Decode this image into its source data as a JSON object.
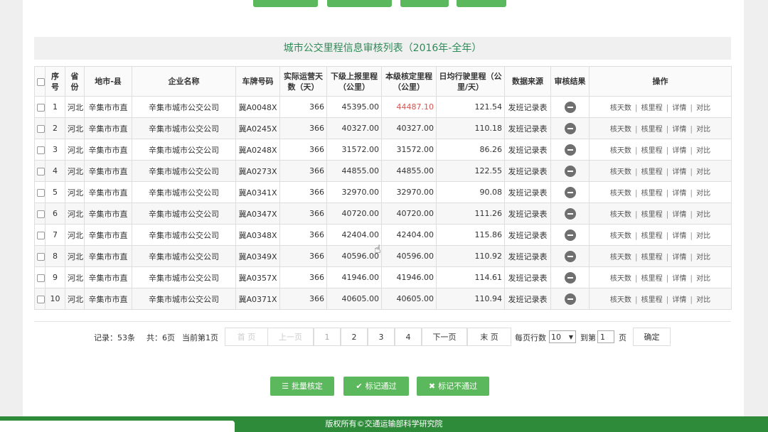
{
  "title": "城市公交里程信息审核列表（2016年-全年）",
  "columns": [
    "序号",
    "省份",
    "地市-县",
    "企业名称",
    "车牌号码",
    "实际运营天数（天）",
    "下级上报里程（公里）",
    "本级核定里程（公里）",
    "日均行驶里程（公里/天）",
    "数据来源",
    "审核结果",
    "操作"
  ],
  "rows": [
    {
      "no": "1",
      "province": "河北",
      "city": "辛集市市直",
      "company": "辛集市城市公交公司",
      "plate": "冀A0048X",
      "days": "366",
      "reported": "45395.00",
      "verified": "44487.10",
      "verified_flag": true,
      "daily": "121.54",
      "source": "发班记录表"
    },
    {
      "no": "2",
      "province": "河北",
      "city": "辛集市市直",
      "company": "辛集市城市公交公司",
      "plate": "冀A0245X",
      "days": "366",
      "reported": "40327.00",
      "verified": "40327.00",
      "verified_flag": false,
      "daily": "110.18",
      "source": "发班记录表"
    },
    {
      "no": "3",
      "province": "河北",
      "city": "辛集市市直",
      "company": "辛集市城市公交公司",
      "plate": "冀A0248X",
      "days": "366",
      "reported": "31572.00",
      "verified": "31572.00",
      "verified_flag": false,
      "daily": "86.26",
      "source": "发班记录表"
    },
    {
      "no": "4",
      "province": "河北",
      "city": "辛集市市直",
      "company": "辛集市城市公交公司",
      "plate": "冀A0273X",
      "days": "366",
      "reported": "44855.00",
      "verified": "44855.00",
      "verified_flag": false,
      "daily": "122.55",
      "source": "发班记录表"
    },
    {
      "no": "5",
      "province": "河北",
      "city": "辛集市市直",
      "company": "辛集市城市公交公司",
      "plate": "冀A0341X",
      "days": "366",
      "reported": "32970.00",
      "verified": "32970.00",
      "verified_flag": false,
      "daily": "90.08",
      "source": "发班记录表"
    },
    {
      "no": "6",
      "province": "河北",
      "city": "辛集市市直",
      "company": "辛集市城市公交公司",
      "plate": "冀A0347X",
      "days": "366",
      "reported": "40720.00",
      "verified": "40720.00",
      "verified_flag": false,
      "daily": "111.26",
      "source": "发班记录表"
    },
    {
      "no": "7",
      "province": "河北",
      "city": "辛集市市直",
      "company": "辛集市城市公交公司",
      "plate": "冀A0348X",
      "days": "366",
      "reported": "42404.00",
      "verified": "42404.00",
      "verified_flag": false,
      "daily": "115.86",
      "source": "发班记录表"
    },
    {
      "no": "8",
      "province": "河北",
      "city": "辛集市市直",
      "company": "辛集市城市公交公司",
      "plate": "冀A0349X",
      "days": "366",
      "reported": "40596.00",
      "verified": "40596.00",
      "verified_flag": false,
      "daily": "110.92",
      "source": "发班记录表"
    },
    {
      "no": "9",
      "province": "河北",
      "city": "辛集市市直",
      "company": "辛集市城市公交公司",
      "plate": "冀A0357X",
      "days": "366",
      "reported": "41946.00",
      "verified": "41946.00",
      "verified_flag": false,
      "daily": "114.61",
      "source": "发班记录表"
    },
    {
      "no": "10",
      "province": "河北",
      "city": "辛集市市直",
      "company": "辛集市城市公交公司",
      "plate": "冀A0371X",
      "days": "366",
      "reported": "40605.00",
      "verified": "40605.00",
      "verified_flag": false,
      "daily": "110.94",
      "source": "发班记录表"
    }
  ],
  "actions": [
    "核天数",
    "核里程",
    "详情",
    "对比"
  ],
  "pager": {
    "records": "记录：53条",
    "pages": "共：6页",
    "current": "当前第1页",
    "first": "首 页",
    "prev": "上一页",
    "page_numbers": [
      "1",
      "2",
      "3",
      "4"
    ],
    "next": "下一页",
    "last": "末 页",
    "per_page_label": "每页行数",
    "per_page_value": "10",
    "goto_label": "到第",
    "goto_value": "1",
    "page_unit": "页",
    "confirm": "确定"
  },
  "buttons": {
    "batch": "批量核定",
    "pass": "标记通过",
    "fail": "标记不通过"
  },
  "footer": "版权所有©交通运输部科学研究院",
  "colors": {
    "accent": "#5cb85c",
    "footer": "#2e8b3a",
    "highlight": "#d9534f"
  }
}
